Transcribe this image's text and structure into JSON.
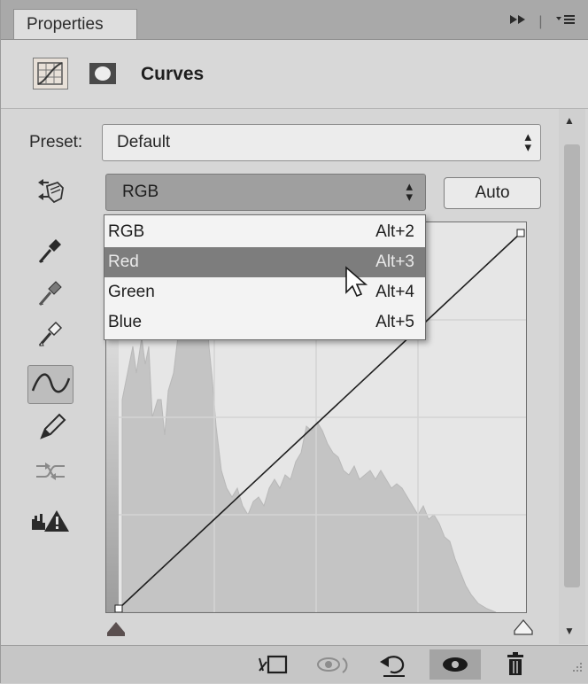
{
  "panel": {
    "tab_label": "Properties",
    "tab_controls_icons": [
      "collapse-icon",
      "panel-menu-icon"
    ]
  },
  "header": {
    "title": "Curves",
    "icons": [
      "curves-adjustment-icon",
      "layer-mask-icon"
    ]
  },
  "preset": {
    "label": "Preset:",
    "value": "Default"
  },
  "channel": {
    "value": "RGB",
    "auto_label": "Auto",
    "menu": [
      {
        "label": "RGB",
        "shortcut": "Alt+2"
      },
      {
        "label": "Red",
        "shortcut": "Alt+3",
        "highlighted": true
      },
      {
        "label": "Green",
        "shortcut": "Alt+4"
      },
      {
        "label": "Blue",
        "shortcut": "Alt+5"
      }
    ]
  },
  "tools": [
    "targeted-adjustment-icon",
    "black-point-eyedropper-icon",
    "gray-point-eyedropper-icon",
    "white-point-eyedropper-icon",
    "edit-curve-points-icon",
    "draw-curve-pencil-icon",
    "smooth-curve-icon",
    "clipping-warning-icon"
  ],
  "active_tool": "edit-curve-points-icon",
  "bottom_bar": {
    "icons": [
      "clip-to-layer-icon",
      "view-previous-state-icon",
      "reset-icon",
      "toggle-visibility-icon",
      "delete-icon"
    ]
  },
  "colors": {
    "panel_bg": "#d6d6d6",
    "highlight": "#7d7d7d",
    "graph_bg": "#e6e6e6",
    "histogram": "#c4c4c4"
  }
}
